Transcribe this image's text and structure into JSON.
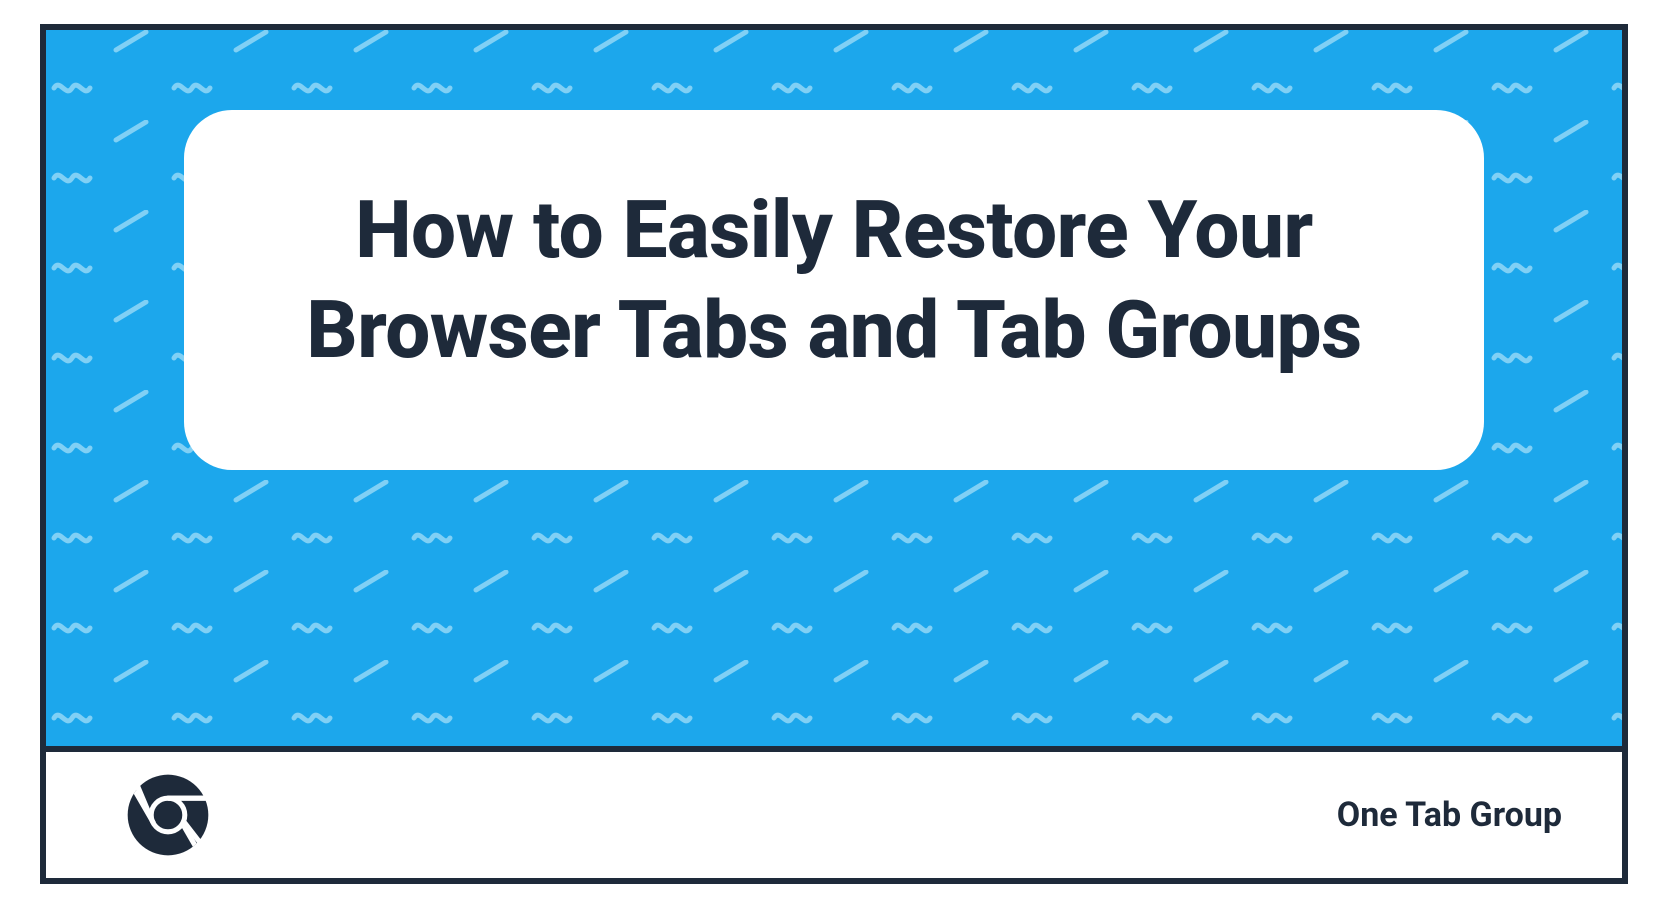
{
  "hero": {
    "title": "How to Easily Restore Your Browser Tabs and Tab Groups"
  },
  "footer": {
    "brand": "One Tab Group"
  },
  "colors": {
    "accent": "#1ca7ec",
    "dark": "#1e2a3a"
  }
}
